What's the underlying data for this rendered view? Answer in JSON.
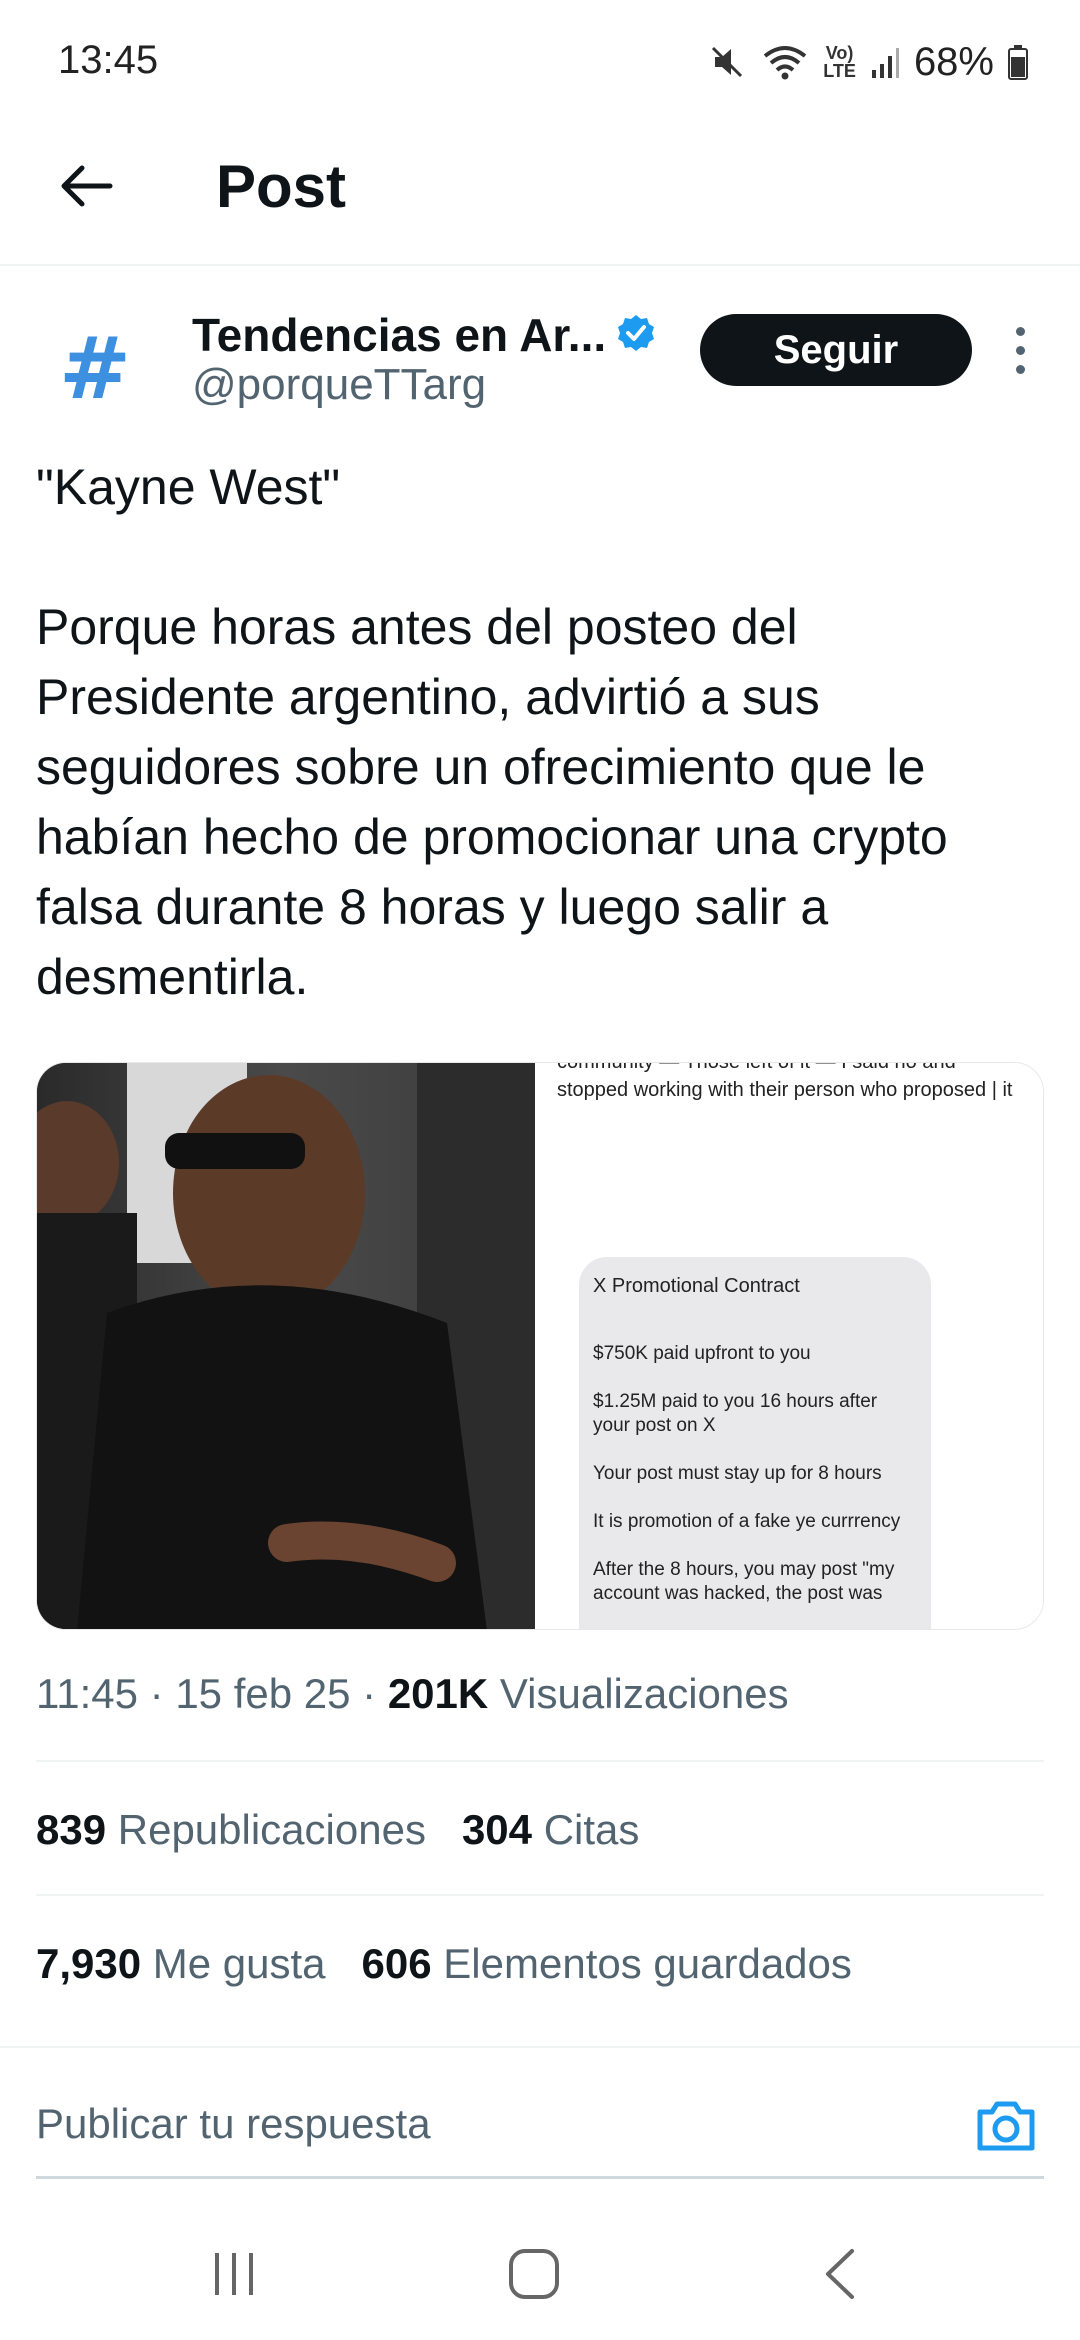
{
  "status": {
    "time": "13:45",
    "battery": "68%",
    "network": "LTE"
  },
  "header": {
    "title": "Post"
  },
  "author": {
    "avatar_glyph": "#",
    "name": "Tendencias en Ar...",
    "handle": "@porqueTTarg",
    "verified": true,
    "follow_label": "Seguir"
  },
  "post": {
    "text": "\"Kayne West\"\n\nPorque horas antes del posteo del Presidente argentino, advirtió a sus seguidores sobre un ofrecimiento que le habían hecho de promocionar una crypto falsa durante 8 horas y luego salir a desmentirla."
  },
  "media": {
    "image_right": {
      "caption_top": "community — Those left of it — I said no and",
      "caption": "stopped working with their person who proposed | it",
      "bubble_title": "X Promotional Contract",
      "bubble_lines": [
        "$750K paid upfront to you",
        "$1.25M paid to you 16 hours after your post on X",
        "Your post must stay up for 8 hours",
        "It is promotion of a fake ye currrency",
        "After the 8 hours, you may post \"my account was hacked, the post was"
      ]
    }
  },
  "meta": {
    "time": "11:45",
    "date": "15 feb 25",
    "views_count": "201K",
    "views_label": "Visualizaciones"
  },
  "stats": {
    "reposts_count": "839",
    "reposts_label": "Republicaciones",
    "quotes_count": "304",
    "quotes_label": "Citas",
    "likes_count": "7,930",
    "likes_label": "Me gusta",
    "bookmarks_count": "606",
    "bookmarks_label": "Elementos guardados"
  },
  "reply": {
    "placeholder": "Publicar tu respuesta"
  },
  "colors": {
    "accent": "#1d9bf0",
    "text_primary": "#0f1419",
    "text_secondary": "#536471",
    "follow_bg": "#0f1419"
  }
}
